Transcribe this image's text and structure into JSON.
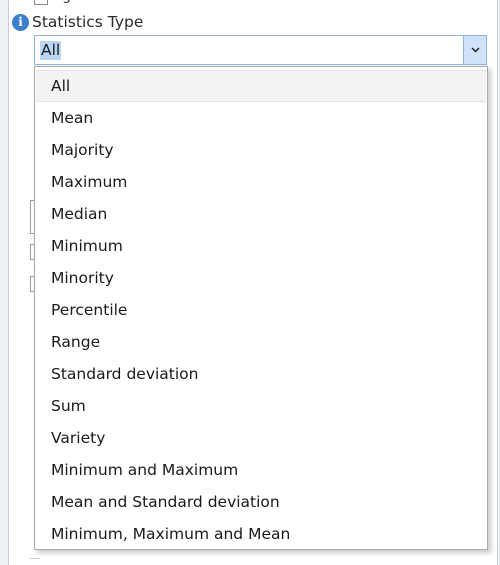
{
  "parameter": {
    "label": "Statistics Type",
    "value": "All"
  },
  "previous_row": {
    "checkbox_label": "Ig"
  },
  "dropdown": {
    "selected": "All",
    "options": [
      {
        "label": "All"
      },
      {
        "label": "Mean"
      },
      {
        "label": "Majority"
      },
      {
        "label": "Maximum"
      },
      {
        "label": "Median"
      },
      {
        "label": "Minimum"
      },
      {
        "label": "Minority"
      },
      {
        "label": "Percentile"
      },
      {
        "label": "Range"
      },
      {
        "label": "Standard deviation"
      },
      {
        "label": "Sum"
      },
      {
        "label": "Variety"
      },
      {
        "label": "Minimum and Maximum"
      },
      {
        "label": "Mean and Standard deviation"
      },
      {
        "label": "Minimum, Maximum and Mean"
      }
    ]
  },
  "icons": {
    "info": "info-icon",
    "dropdown_arrow": "chevron-down-icon"
  },
  "colors": {
    "accent": "#3c7fc9",
    "combo_border": "#8db2e3",
    "selection_highlight": "#b9d7f4",
    "selected_option_bg": "#f3f3f3"
  }
}
